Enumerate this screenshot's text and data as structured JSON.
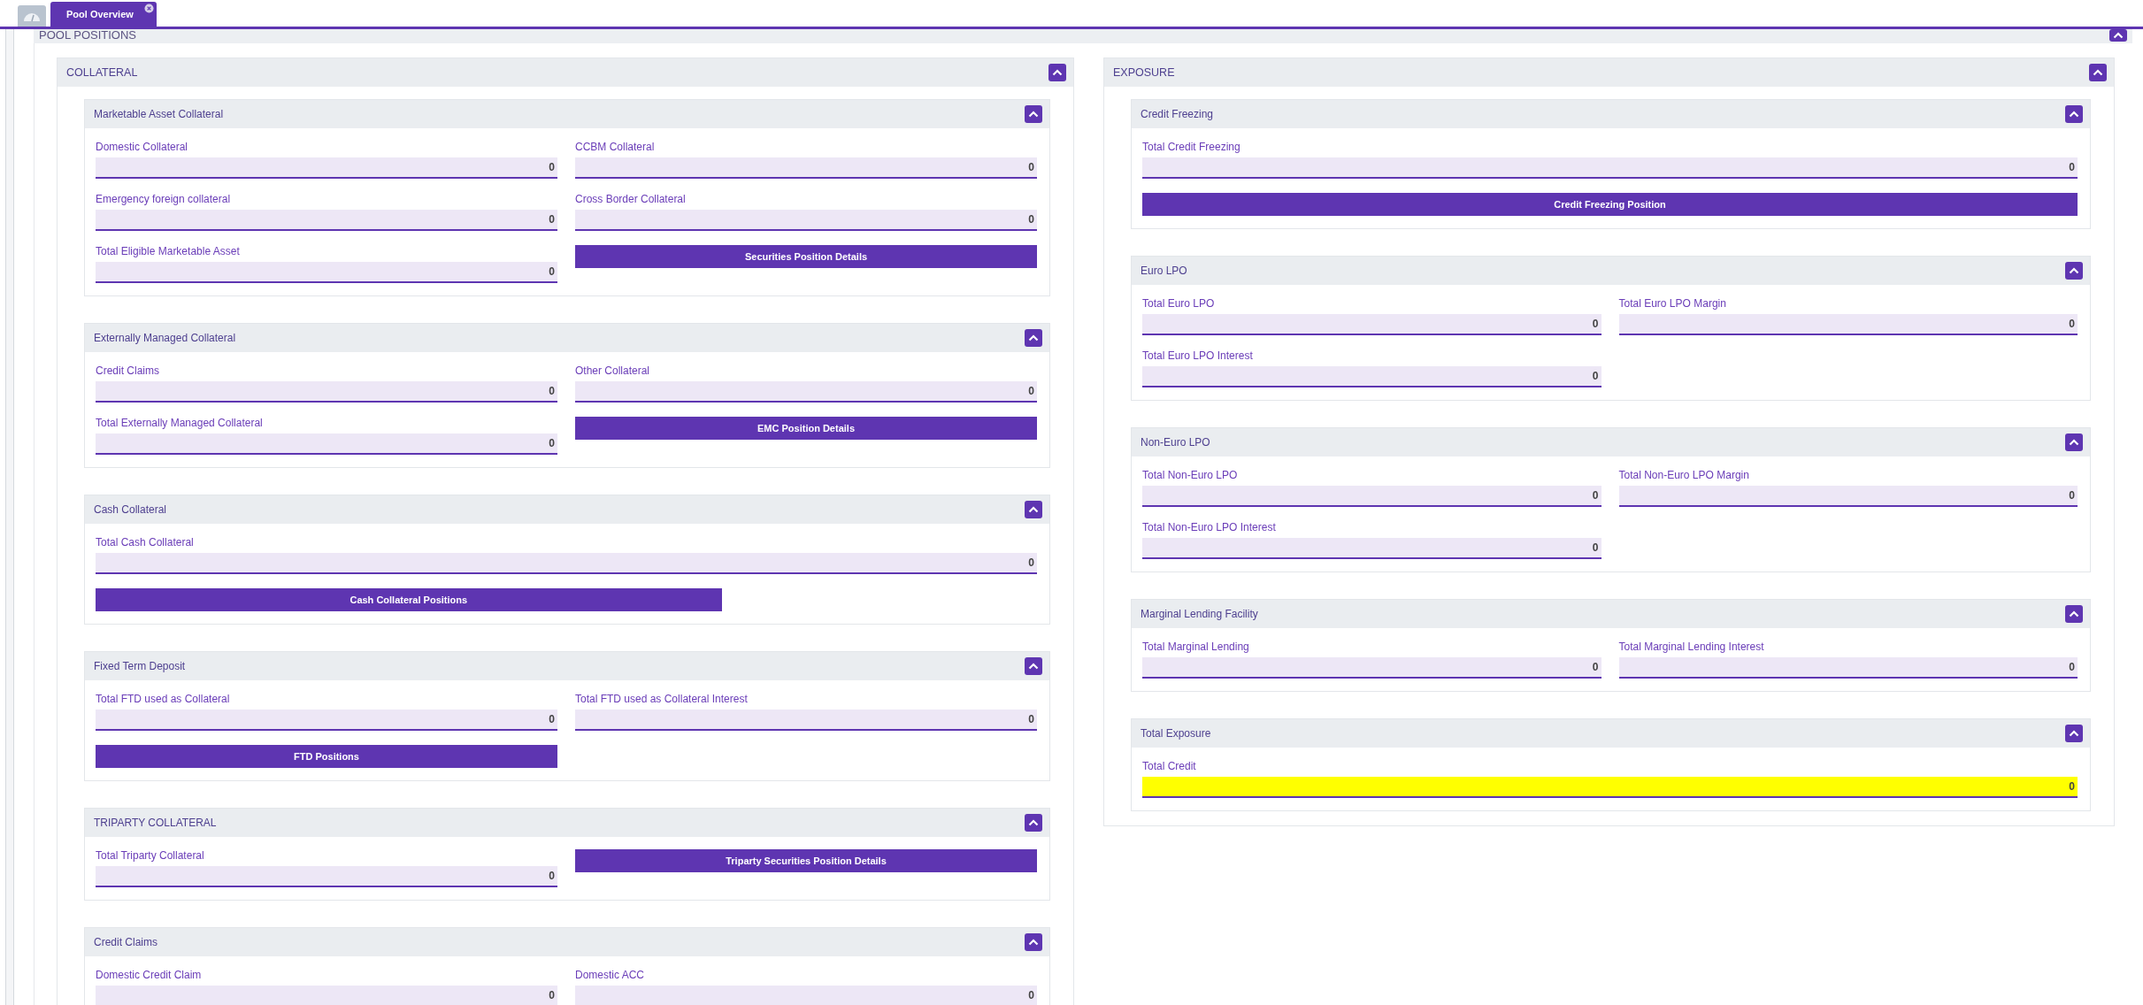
{
  "tabs": [
    {
      "kind": "icon",
      "selected": false
    },
    {
      "kind": "text",
      "label": "Pool Overview",
      "selected": true
    }
  ],
  "pool_positions": {
    "title": "POOL POSITIONS",
    "columns": [
      {
        "title": "COLLATERAL",
        "sections": [
          {
            "title": "Marketable Asset Collateral",
            "items": [
              {
                "kind": "field",
                "label": "Domestic Collateral",
                "value": "0",
                "highlighted": false
              },
              {
                "kind": "field",
                "label": "CCBM Collateral",
                "value": "0",
                "highlighted": false
              },
              {
                "kind": "field",
                "label": "Emergency foreign collateral",
                "value": "0",
                "highlighted": false
              },
              {
                "kind": "field",
                "label": "Cross Border Collateral",
                "value": "0",
                "highlighted": false
              },
              {
                "kind": "field",
                "label": "Total Eligible Marketable Asset",
                "value": "0",
                "highlighted": false
              },
              {
                "kind": "button",
                "label": "Securities Position Details"
              }
            ]
          },
          {
            "title": "Externally Managed Collateral",
            "items": [
              {
                "kind": "field",
                "label": "Credit Claims",
                "value": "0",
                "highlighted": false
              },
              {
                "kind": "field",
                "label": "Other Collateral",
                "value": "0",
                "highlighted": false
              },
              {
                "kind": "field",
                "label": "Total Externally Managed Collateral",
                "value": "0",
                "highlighted": false
              },
              {
                "kind": "button",
                "label": "EMC Position Details"
              }
            ]
          },
          {
            "title": "Cash Collateral",
            "items": [
              {
                "kind": "full_field",
                "label": "Total Cash Collateral",
                "value": "0",
                "highlighted": false
              },
              {
                "kind": "long_button",
                "label": "Cash Collateral Positions"
              }
            ]
          },
          {
            "title": "Fixed Term Deposit",
            "items": [
              {
                "kind": "field",
                "label": "Total FTD used as Collateral",
                "value": "0",
                "highlighted": false
              },
              {
                "kind": "field",
                "label": "Total FTD used as Collateral Interest",
                "value": "0",
                "highlighted": false
              },
              {
                "kind": "button",
                "label": "FTD Positions"
              }
            ]
          },
          {
            "title": "TRIPARTY COLLATERAL",
            "items": [
              {
                "kind": "field",
                "label": "Total Triparty Collateral",
                "value": "0",
                "highlighted": false
              },
              {
                "kind": "button",
                "label": "Triparty Securities Position Details"
              }
            ]
          },
          {
            "title": "Credit Claims",
            "items": [
              {
                "kind": "field",
                "label": "Domestic Credit Claim",
                "value": "0",
                "highlighted": false
              },
              {
                "kind": "field",
                "label": "Domestic ACC",
                "value": "0",
                "highlighted": false
              }
            ]
          }
        ]
      },
      {
        "title": "EXPOSURE",
        "sections": [
          {
            "title": "Credit Freezing",
            "items": [
              {
                "kind": "full_field",
                "label": "Total Credit Freezing",
                "value": "0",
                "highlighted": false
              },
              {
                "kind": "full_button",
                "label": "Credit Freezing Position"
              }
            ]
          },
          {
            "title": "Euro LPO",
            "items": [
              {
                "kind": "field",
                "label": "Total Euro LPO",
                "value": "0",
                "highlighted": false
              },
              {
                "kind": "field",
                "label": "Total Euro LPO Margin",
                "value": "0",
                "highlighted": false
              },
              {
                "kind": "field",
                "label": "Total Euro LPO Interest",
                "value": "0",
                "highlighted": false
              }
            ]
          },
          {
            "title": "Non-Euro LPO",
            "items": [
              {
                "kind": "field",
                "label": "Total Non-Euro LPO",
                "value": "0",
                "highlighted": false
              },
              {
                "kind": "field",
                "label": "Total Non-Euro LPO Margin",
                "value": "0",
                "highlighted": false
              },
              {
                "kind": "field",
                "label": "Total Non-Euro LPO Interest",
                "value": "0",
                "highlighted": false
              }
            ]
          },
          {
            "title": "Marginal Lending Facility",
            "items": [
              {
                "kind": "field",
                "label": "Total Marginal Lending",
                "value": "0",
                "highlighted": false
              },
              {
                "kind": "field",
                "label": "Total Marginal Lending Interest",
                "value": "0",
                "highlighted": false
              }
            ]
          },
          {
            "title": "Total Exposure",
            "items": [
              {
                "kind": "full_field",
                "label": "Total Credit",
                "value": "0",
                "highlighted": true
              }
            ]
          }
        ]
      }
    ]
  }
}
